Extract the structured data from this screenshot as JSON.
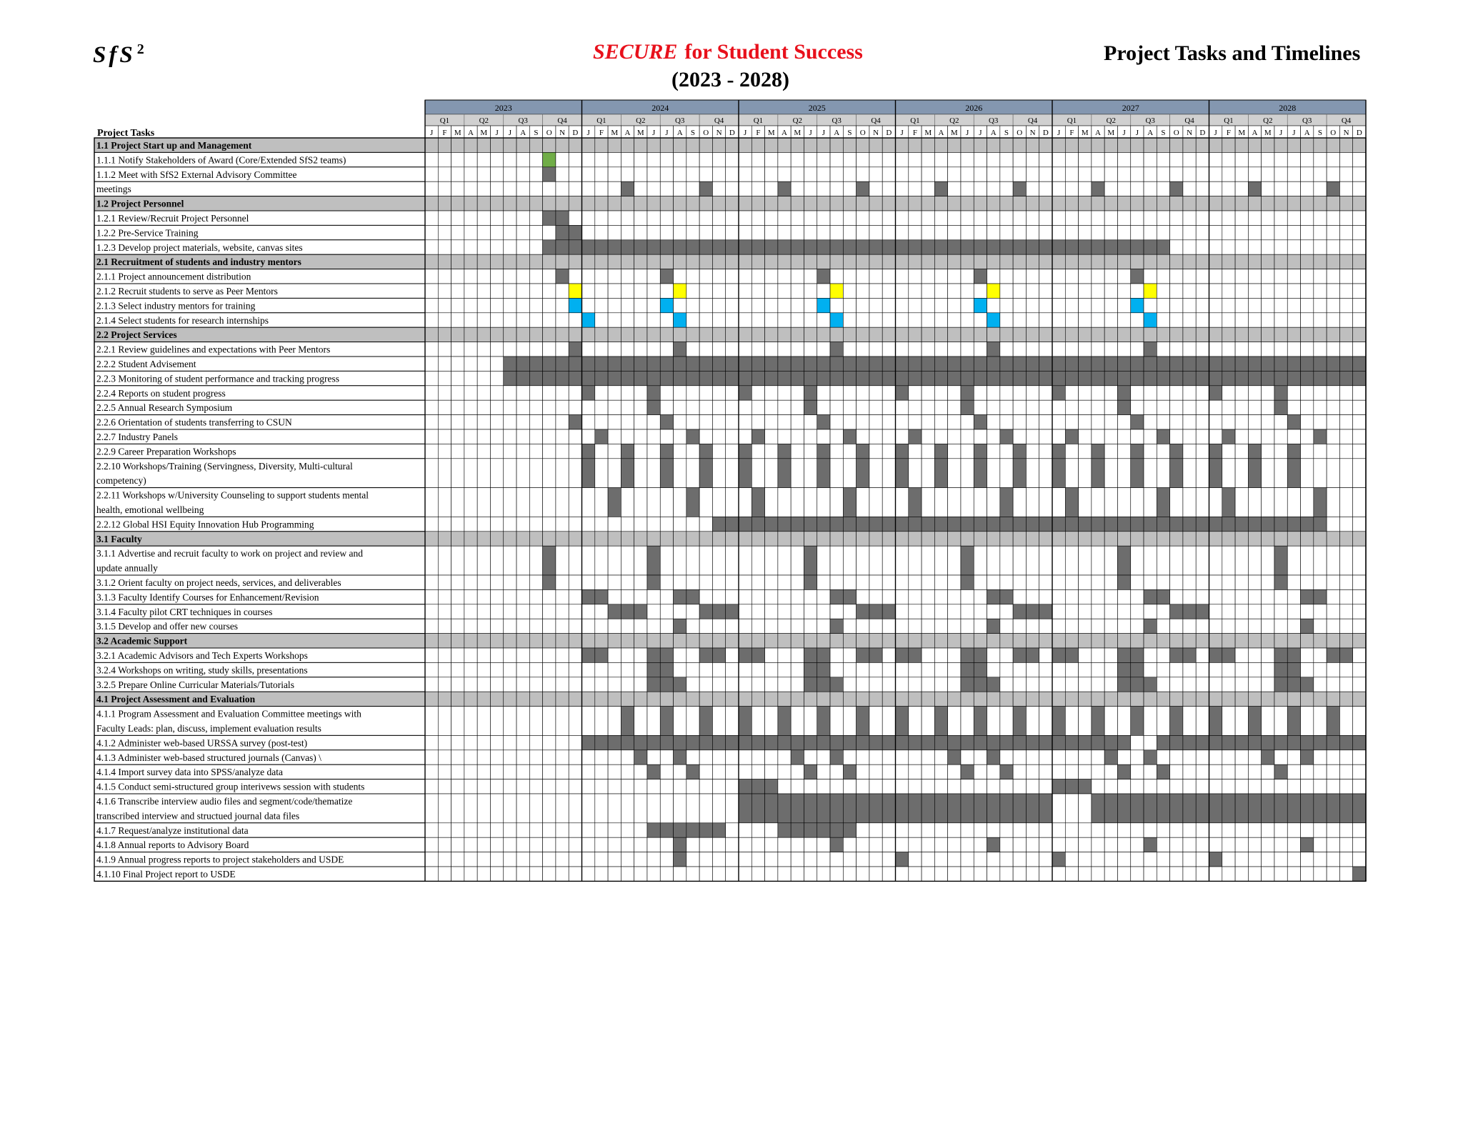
{
  "header": {
    "logo_text": "SfS",
    "logo_sup": "2",
    "title_italic": "SECURE",
    "title_rest": "for Student Success",
    "subtitle": "(2023 - 2028)",
    "doc_heading": "Project Tasks and Timelines"
  },
  "table": {
    "tasks_header": "Project Tasks",
    "years": [
      "2023",
      "2024",
      "2025",
      "2026",
      "2027",
      "2028"
    ],
    "quarters": [
      "Q1",
      "Q2",
      "Q3",
      "Q4"
    ],
    "months": [
      "J",
      "F",
      "M",
      "A",
      "M",
      "J",
      "J",
      "A",
      "S",
      "O",
      "N",
      "D"
    ],
    "colors": {
      "header_blue": "#8497b0",
      "header_gray": "#d0d0d0",
      "section_gray": "#bfbfbf",
      "bar": "#6d6d6d",
      "green": "#70ad47",
      "yellow": "#ffff00",
      "blue": "#00b0f0"
    },
    "rows": [
      {
        "lines": [
          "1.1 Project Start up and Management"
        ],
        "section": true
      },
      {
        "lines": [
          "1.1.1 Notify Stakeholders of Award (Core/Extended SfS2 teams)"
        ],
        "cells": [
          [
            10,
            "green"
          ]
        ]
      },
      {
        "lines": [
          "1.1.2 Meet with SfS2 External Advisory Committee"
        ],
        "cells": [
          10
        ]
      },
      {
        "lines": [
          "meetings"
        ],
        "cells": [
          16,
          22,
          28,
          34,
          40,
          46,
          52,
          58,
          64,
          70
        ]
      },
      {
        "lines": [
          "1.2 Project Personnel"
        ],
        "section": true
      },
      {
        "lines": [
          "1.2.1 Review/Recruit Project Personnel"
        ],
        "cells": [
          [
            10,
            11
          ]
        ]
      },
      {
        "lines": [
          "1.2.2 Pre-Service Training"
        ],
        "cells": [
          [
            11,
            12
          ]
        ]
      },
      {
        "lines": [
          "1.2.3 Develop project materials, website, canvas sites"
        ],
        "cells": [
          [
            10,
            57
          ]
        ]
      },
      {
        "lines": [
          "2.1 Recruitment of students and industry mentors"
        ],
        "section": true
      },
      {
        "lines": [
          "2.1.1 Project announcement distribution"
        ],
        "cells": [
          11,
          19,
          31,
          43,
          55
        ]
      },
      {
        "lines": [
          "2.1.2 Recruit students to serve as Peer Mentors"
        ],
        "cells": [
          [
            12,
            "yellow"
          ],
          [
            20,
            "yellow"
          ],
          [
            32,
            "yellow"
          ],
          [
            44,
            "yellow"
          ],
          [
            56,
            "yellow"
          ]
        ]
      },
      {
        "lines": [
          "2.1.3 Select industry mentors for training"
        ],
        "cells": [
          [
            12,
            "blue"
          ],
          [
            19,
            "blue"
          ],
          [
            31,
            "blue"
          ],
          [
            43,
            "blue"
          ],
          [
            55,
            "blue"
          ]
        ]
      },
      {
        "lines": [
          "2.1.4 Select students for research internships"
        ],
        "cells": [
          [
            13,
            "blue"
          ],
          [
            20,
            "blue"
          ],
          [
            32,
            "blue"
          ],
          [
            44,
            "blue"
          ],
          [
            56,
            "blue"
          ]
        ]
      },
      {
        "lines": [
          "2.2 Project Services"
        ],
        "section": true
      },
      {
        "lines": [
          "2.2.1 Review guidelines and expectations with Peer Mentors"
        ],
        "cells": [
          12,
          20,
          32,
          44,
          56
        ]
      },
      {
        "lines": [
          "2.2.2 Student Advisement"
        ],
        "cells": [
          [
            7,
            72
          ]
        ]
      },
      {
        "lines": [
          "2.2.3 Monitoring of student performance and tracking progress"
        ],
        "cells": [
          [
            7,
            72
          ]
        ]
      },
      {
        "lines": [
          "2.2.4 Reports on student progress"
        ],
        "cells": [
          13,
          18,
          25,
          30,
          37,
          42,
          49,
          54,
          61,
          66
        ]
      },
      {
        "lines": [
          "2.2.5 Annual Research Symposium"
        ],
        "cells": [
          18,
          30,
          42,
          54,
          66
        ]
      },
      {
        "lines": [
          "2.2.6 Orientation of students transferring to CSUN"
        ],
        "cells": [
          12,
          19,
          31,
          43,
          55,
          67
        ]
      },
      {
        "lines": [
          "2.2.7 Industry Panels"
        ],
        "cells": [
          14,
          21,
          26,
          33,
          38,
          45,
          50,
          57,
          62,
          69
        ]
      },
      {
        "lines": [
          "2.2.9 Career Preparation Workshops"
        ],
        "cells": [
          13,
          16,
          19,
          22,
          25,
          28,
          31,
          34,
          37,
          40,
          43,
          46,
          49,
          52,
          55,
          58,
          61,
          64,
          67
        ]
      },
      {
        "lines": [
          "2.2.10 Workshops/Training (Servingness, Diversity, Multi-cultural",
          "competency)"
        ],
        "cells": [
          13,
          16,
          19,
          22,
          25,
          28,
          31,
          34,
          37,
          40,
          43,
          46,
          49,
          52,
          55,
          58,
          61,
          64,
          67
        ]
      },
      {
        "lines": [
          "2.2.11 Workshops w/University Counseling to support students mental",
          "health, emotional wellbeing"
        ],
        "cells": [
          15,
          21,
          26,
          33,
          38,
          45,
          50,
          57,
          62,
          69
        ]
      },
      {
        "lines": [
          "2.2.12 Global HSI Equity Innovation Hub Programming"
        ],
        "cells": [
          [
            23,
            69
          ]
        ]
      },
      {
        "lines": [
          "3.1 Faculty"
        ],
        "section": true
      },
      {
        "lines": [
          "3.1.1 Advertise and recruit faculty to work on project and review and",
          "update annually"
        ],
        "cells": [
          10,
          18,
          30,
          42,
          54,
          66
        ]
      },
      {
        "lines": [
          "3.1.2 Orient faculty on project needs, services, and deliverables"
        ],
        "cells": [
          10,
          18,
          30,
          42,
          54,
          66
        ]
      },
      {
        "lines": [
          "3.1.3 Faculty Identify Courses for Enhancement/Revision"
        ],
        "cells": [
          [
            13,
            14
          ],
          [
            20,
            21
          ],
          [
            32,
            33
          ],
          [
            44,
            45
          ],
          [
            56,
            57
          ],
          [
            68,
            69
          ]
        ]
      },
      {
        "lines": [
          "3.1.4 Faculty pilot CRT techniques in courses"
        ],
        "cells": [
          [
            15,
            17
          ],
          [
            22,
            24
          ],
          [
            34,
            36
          ],
          [
            46,
            48
          ],
          [
            58,
            60
          ]
        ]
      },
      {
        "lines": [
          "3.1.5 Develop and offer new courses"
        ],
        "cells": [
          20,
          32,
          44,
          56,
          68
        ]
      },
      {
        "lines": [
          "3.2 Academic Support"
        ],
        "section": true
      },
      {
        "lines": [
          "3.2.1 Academic Advisors and Tech Experts Workshops"
        ],
        "cells": [
          [
            13,
            14
          ],
          [
            18,
            19
          ],
          [
            22,
            23
          ],
          [
            25,
            26
          ],
          [
            30,
            31
          ],
          [
            34,
            35
          ],
          [
            37,
            38
          ],
          [
            42,
            43
          ],
          [
            46,
            47
          ],
          [
            49,
            50
          ],
          [
            54,
            55
          ],
          [
            58,
            59
          ],
          [
            61,
            62
          ],
          [
            66,
            67
          ],
          [
            70,
            71
          ]
        ]
      },
      {
        "lines": [
          "3.2.4 Workshops on writing, study skills, presentations"
        ],
        "cells": [
          [
            18,
            19
          ],
          [
            30,
            31
          ],
          [
            42,
            43
          ],
          [
            54,
            55
          ],
          [
            66,
            67
          ]
        ]
      },
      {
        "lines": [
          "3.2.5 Prepare Online Curricular Materials/Tutorials"
        ],
        "cells": [
          [
            18,
            20
          ],
          [
            30,
            32
          ],
          [
            42,
            44
          ],
          [
            54,
            56
          ],
          [
            66,
            68
          ]
        ]
      },
      {
        "lines": [
          "4.1 Project Assessment and Evaluation"
        ],
        "section": true
      },
      {
        "lines": [
          "4.1.1 Program Assessment and Evaluation Committee meetings with",
          "Faculty Leads: plan, discuss, implement evaluation results"
        ],
        "cells": [
          16,
          19,
          22,
          25,
          28,
          31,
          34,
          37,
          40,
          43,
          46,
          49,
          52,
          55,
          58,
          61,
          64,
          67,
          70
        ]
      },
      {
        "lines": [
          "4.1.2 Administer web-based URSSA survey (post-test)"
        ],
        "cells": [
          [
            13,
            54
          ],
          [
            57,
            72
          ]
        ]
      },
      {
        "lines": [
          "4.1.3 Administer web-based structured journals (Canvas) \\"
        ],
        "cells": [
          17,
          20,
          29,
          32,
          41,
          44,
          53,
          56,
          65,
          68
        ]
      },
      {
        "lines": [
          "4.1.4 Import survey data into SPSS/analyze data"
        ],
        "cells": [
          18,
          21,
          30,
          33,
          42,
          45,
          54,
          57,
          66
        ]
      },
      {
        "lines": [
          "4.1.5 Conduct semi-structured group interivews session with students"
        ],
        "cells": [
          [
            25,
            27
          ],
          [
            49,
            51
          ]
        ]
      },
      {
        "lines": [
          "4.1.6 Transcribe interview audio files and segment/code/thematize",
          "transcribed interview and structued journal data files"
        ],
        "cells": [
          [
            25,
            48
          ],
          [
            52,
            72
          ]
        ]
      },
      {
        "lines": [
          "4.1.7 Request/analyze institutional data"
        ],
        "cells": [
          [
            18,
            23
          ],
          [
            28,
            33
          ]
        ]
      },
      {
        "lines": [
          "4.1.8 Annual reports to Advisory Board"
        ],
        "cells": [
          20,
          32,
          44,
          56,
          68
        ]
      },
      {
        "lines": [
          "4.1.9 Annual progress reports to project stakeholders and USDE"
        ],
        "cells": [
          20,
          37,
          49,
          61
        ]
      },
      {
        "lines": [
          "4.1.10 Final Project report to USDE"
        ],
        "cells": [
          72
        ]
      }
    ]
  }
}
